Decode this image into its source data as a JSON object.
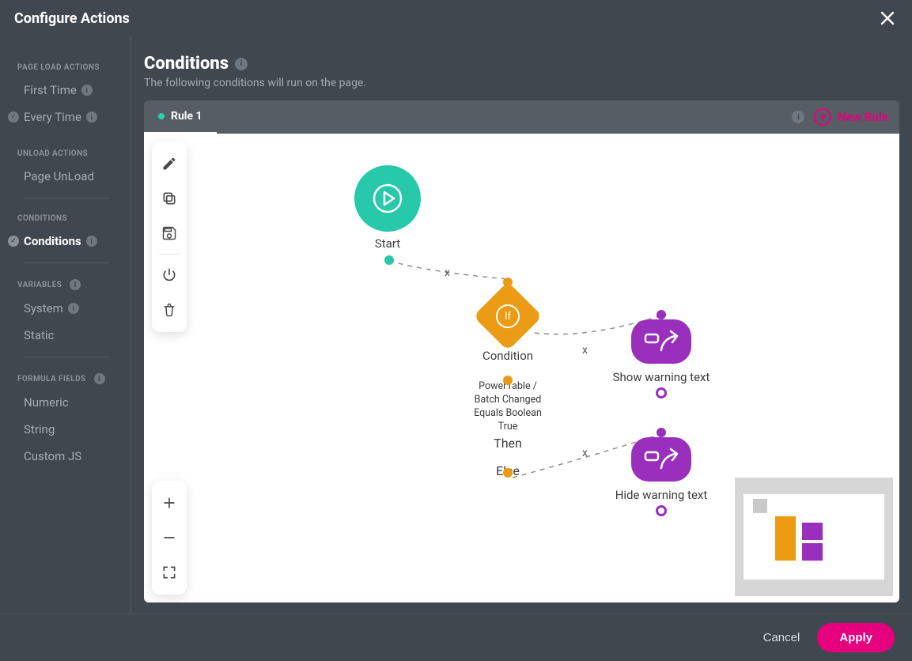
{
  "titlebar": {
    "title": "Configure Actions"
  },
  "sidebar": {
    "section1": "PAGE LOAD ACTIONS",
    "item_first_time": "First Time",
    "item_every_time": "Every Time",
    "section2": "UNLOAD ACTIONS",
    "item_page_unload": "Page UnLoad",
    "section3": "CONDITIONS",
    "item_conditions": "Conditions",
    "section4": "VARIABLES",
    "item_system": "System",
    "item_static": "Static",
    "section5": "FORMULA FIELDS",
    "item_numeric": "Numeric",
    "item_string": "String",
    "item_customjs": "Custom JS"
  },
  "header": {
    "title": "Conditions",
    "subtitle": "The following conditions will run on the page."
  },
  "tabs": {
    "rule1": "Rule 1",
    "new_rule": "New Rule"
  },
  "flow": {
    "start_label": "Start",
    "condition_label": "Condition",
    "condition_detail_l1": "PowerTable /",
    "condition_detail_l2": "Batch Changed",
    "condition_detail_l3": "Equals Boolean",
    "condition_detail_l4": "True",
    "then_label": "Then",
    "else_label": "Else",
    "action_show": "Show warning text",
    "action_hide": "Hide warning text",
    "if_glyph": "If",
    "edge_x": "x"
  },
  "footer": {
    "cancel": "Cancel",
    "apply": "Apply"
  },
  "colors": {
    "accent_pink": "#e6007e",
    "teal": "#27c9aa",
    "orange": "#eb9c14",
    "purple": "#992fbc",
    "bg_dark": "#3f474f"
  }
}
